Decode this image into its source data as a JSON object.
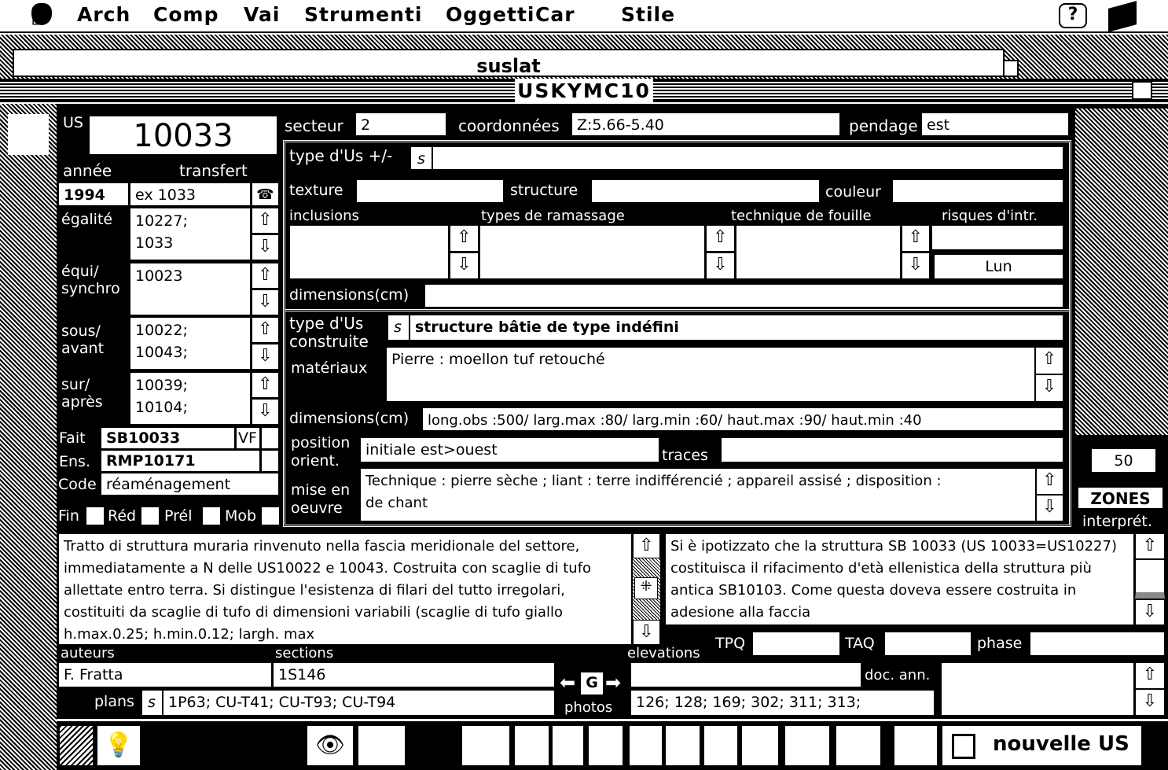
{
  "menubar": {
    "items": [
      "Arch",
      "Comp",
      "Vai",
      "Strumenti",
      "Oggetti",
      "Car",
      "Stile"
    ]
  },
  "back_window": {
    "title": "suslat"
  },
  "window": {
    "title": "USKYMC10"
  },
  "left": {
    "us_label": "US",
    "us_value": "10033",
    "annee_label": "année",
    "transfert_label": "transfert",
    "annee": "1994",
    "transfert": "ex 1033",
    "egalite_label": "égalité",
    "egalite": "10227;\n1033",
    "equi_label": "équi/\nsynchro",
    "equi": "10023",
    "sous_label": "sous/\navant",
    "sous": "10022;\n10043;",
    "sur_label": "sur/\naprès",
    "sur": "10039;\n10104;",
    "fait_label": "Fait",
    "fait": "SB10033",
    "vf": "VF",
    "ens_label": "Ens.",
    "ens": "RMP10171",
    "code_label": "Code",
    "code": "réaménagement",
    "checks": [
      "Fin",
      "Réd",
      "Prél",
      "Mob"
    ]
  },
  "top": {
    "secteur_label": "secteur",
    "secteur": "2",
    "coord_label": "coordonnées",
    "coord": "Z:5.66-5.40",
    "pendage_label": "pendage",
    "pendage": "est"
  },
  "form": {
    "type_us_label": "type d'Us +/-",
    "s": "s",
    "texture_label": "texture",
    "structure_label": "structure",
    "couleur_label": "couleur",
    "inclusions_label": "inclusions",
    "ramassage_label": "types de ramassage",
    "fouille_label": "technique de fouille",
    "risques_label": "risques d'intr.",
    "risques_value": "Lun",
    "dimensions_label": "dimensions(cm)",
    "type_construite_label": "type d'Us\nconstruite",
    "type_construite": "structure bâtie de type indéfini",
    "materiaux_label": "matériaux",
    "materiaux": "Pierre : moellon tuf retouché",
    "dimensions2_label": "dimensions(cm)",
    "dimensions2": "long.obs :500/ larg.max :80/ larg.min :60/ haut.max :90/ haut.min :40",
    "position_label": "position\norient.",
    "position": "initiale est>ouest",
    "traces_label": "traces",
    "mise_label": "mise en\noeuvre",
    "mise": "Technique : pierre sèche ; liant : terre indifférencié ; appareil assisé ; disposition :\nde chant"
  },
  "right": {
    "zones_count": "50",
    "zones_label": "ZONES",
    "interpret_label": "interprét."
  },
  "bottom": {
    "description": "Tratto di struttura muraria  rinvenuto nella fascia meridionale del settore, immediatamente a N delle US10022 e 10043. Costruita con scaglie di tufo allettate entro terra. Si distingue l'esistenza di filari del tutto irregolari, costituiti da scaglie di tufo di dimensioni variabili (scaglie di tufo giallo h.max.0.25; h.min.0.12; largh. max",
    "interpretation": "Si è ipotizzato che la struttura SB 10033 (US 10033=US10227) costituisca il rifacimento d'età ellenistica della struttura più antica SB10103. Come questa doveva essere costruita in adesione alla faccia",
    "auteurs_label": "auteurs",
    "auteurs": "F. Fratta",
    "sections_label": "sections",
    "sections": "1S146",
    "elevations_label": "elevations",
    "tpq_label": "TPQ",
    "taq_label": "TAQ",
    "phase_label": "phase",
    "plans_label": "plans",
    "plans": "1P63; CU-T41; CU-T93; CU-T94",
    "photos_label": "photos",
    "photos_btn": "G",
    "photos_value": "126; 128; 169; 302; 311; 313;",
    "docann_label": "doc. ann."
  },
  "toolbar": {
    "new_us": "nouvelle US"
  }
}
